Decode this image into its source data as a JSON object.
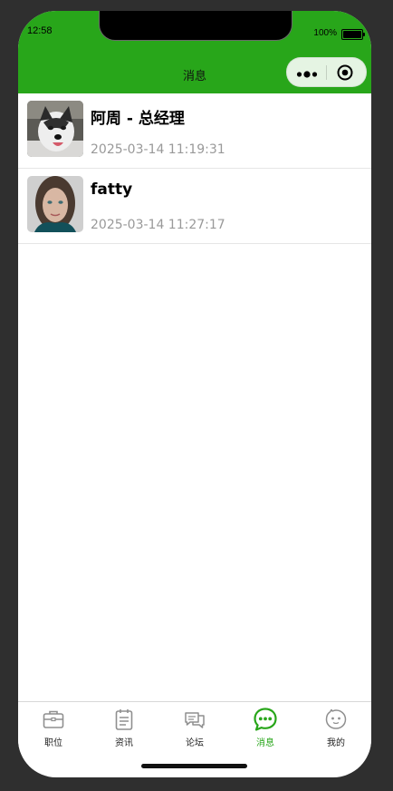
{
  "status_bar": {
    "time": "12:58",
    "battery": "100%"
  },
  "nav": {
    "title": "消息",
    "more_icon": "more-dots-icon",
    "close_icon": "target-circle-icon"
  },
  "colors": {
    "brand": "#28a61a",
    "muted": "#999999",
    "divider": "#e6e6e6"
  },
  "messages": [
    {
      "name": "阿周 - 总经理",
      "time": "2025-03-14 11:19:31",
      "avatar": "husky-dog-photo"
    },
    {
      "name": "fatty",
      "time": "2025-03-14 11:27:17",
      "avatar": "woman-portrait-photo"
    }
  ],
  "tabbar": {
    "active": "消息",
    "tabs": [
      {
        "label": "职位",
        "icon": "briefcase-icon"
      },
      {
        "label": "资讯",
        "icon": "notepad-icon"
      },
      {
        "label": "论坛",
        "icon": "chat-bubbles-icon"
      },
      {
        "label": "消息",
        "icon": "message-dots-icon"
      },
      {
        "label": "我的",
        "icon": "smiley-face-icon"
      }
    ]
  }
}
